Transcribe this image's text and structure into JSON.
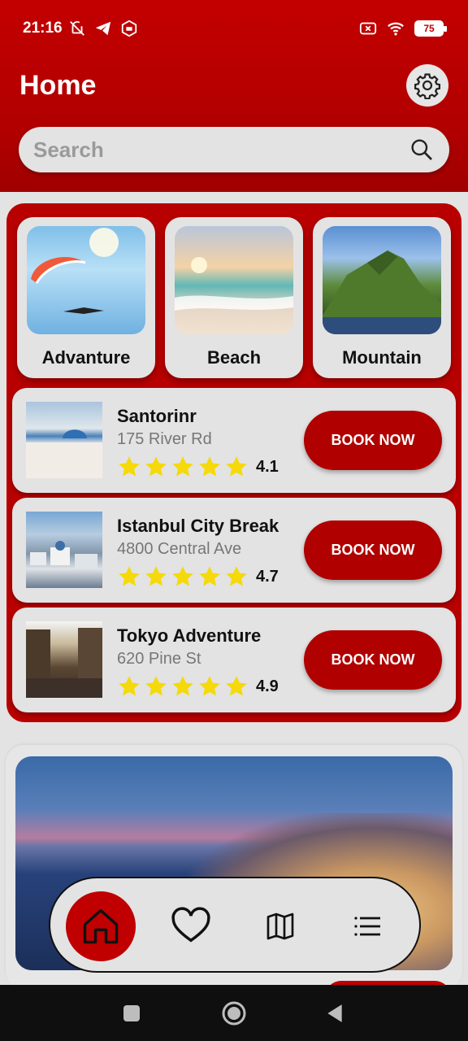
{
  "status_bar": {
    "time": "21:16",
    "battery": "75",
    "icons": [
      "mute-icon",
      "telegram-icon",
      "mi-icon",
      "sim-off-icon",
      "wifi-icon",
      "battery-icon"
    ]
  },
  "header": {
    "title": "Home",
    "settings_icon": "gear-icon"
  },
  "search": {
    "placeholder": "Search",
    "icon": "search-icon"
  },
  "categories": [
    {
      "label": "Advanture",
      "image": "paraglider-sky"
    },
    {
      "label": "Beach",
      "image": "beach-sunset"
    },
    {
      "label": "Mountain",
      "image": "green-mountain"
    }
  ],
  "trips": [
    {
      "title": "Santorinr",
      "address": "175 River Rd",
      "rating": "4.1",
      "stars": 5,
      "button": "BOOK NOW"
    },
    {
      "title": "Istanbul City Break",
      "address": "4800 Central Ave",
      "rating": "4.7",
      "stars": 5,
      "button": "BOOK NOW"
    },
    {
      "title": "Tokyo Adventure",
      "address": "620 Pine St",
      "rating": "4.9",
      "stars": 5,
      "button": "BOOK NOW"
    }
  ],
  "bottom_nav": {
    "items": [
      "home-icon",
      "heart-icon",
      "map-icon",
      "menu-icon"
    ],
    "active": "home-icon"
  },
  "system_nav": [
    "recents-icon",
    "home-circle-icon",
    "back-icon"
  ],
  "colors": {
    "primary": "#b80000",
    "background": "#e3e3e3",
    "star": "#f5d90a"
  }
}
